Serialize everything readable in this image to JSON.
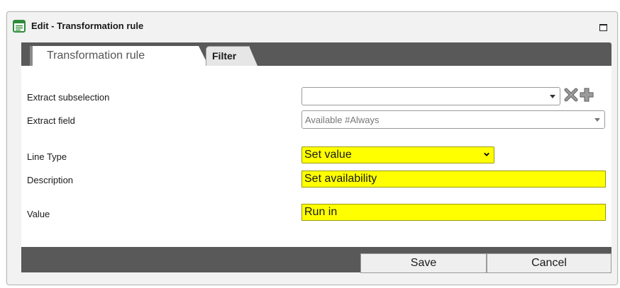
{
  "window": {
    "title": "Edit - Transformation rule"
  },
  "tabs": [
    {
      "label": "Transformation rule",
      "active": true
    },
    {
      "label": "Filter",
      "active": false
    }
  ],
  "form": {
    "extract_subselection": {
      "label": "Extract subselection",
      "value": ""
    },
    "extract_field": {
      "label": "Extract field",
      "value": "Available #Always"
    },
    "line_type": {
      "label": "Line Type",
      "value": "Set value"
    },
    "description": {
      "label": "Description",
      "value": "Set availability"
    },
    "value": {
      "label": "Value",
      "value": "Run in"
    }
  },
  "icons": {
    "title": "form-icon",
    "clear": "clear-x-icon",
    "add": "add-plus-icon"
  },
  "colors": {
    "highlight": "#ffff00",
    "dark_bar": "#595959",
    "title_icon": "#2e8b3a"
  },
  "buttons": {
    "save": "Save",
    "cancel": "Cancel"
  }
}
